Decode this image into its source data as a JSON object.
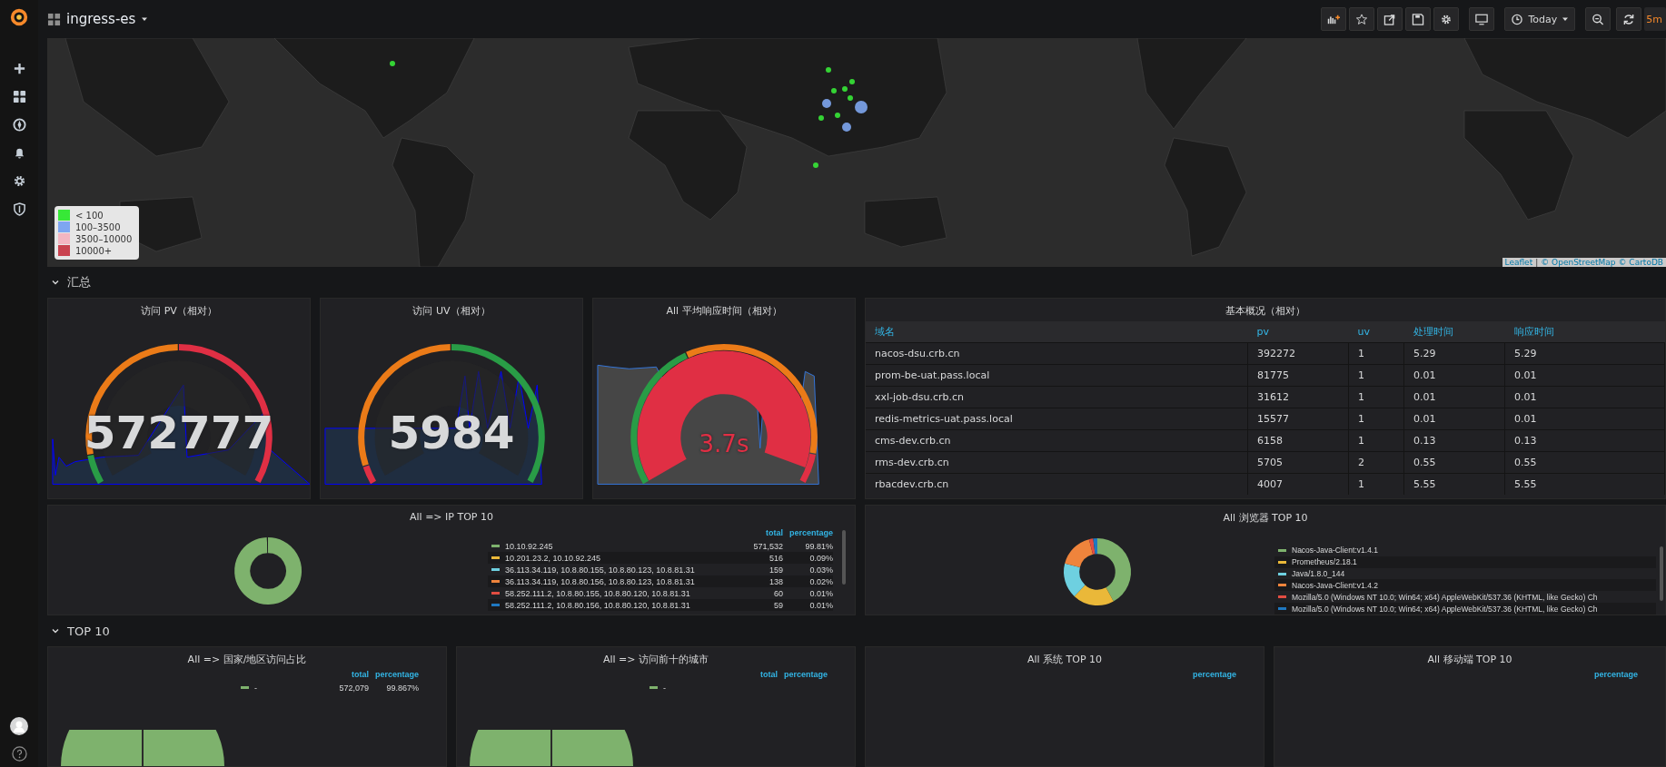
{
  "dashboard": {
    "title": "ingress-es"
  },
  "toolbar": {
    "time_range": "Today",
    "refresh_interval": "5m"
  },
  "map": {
    "legend": [
      {
        "label": "< 100",
        "color": "#37e837"
      },
      {
        "label": "100–3500",
        "color": "#7ea6f0"
      },
      {
        "label": "3500–10000",
        "color": "#f4b6c2"
      },
      {
        "label": "10000+",
        "color": "#c9424f"
      }
    ],
    "attribution": {
      "leaflet": "Leaflet",
      "sep": "|",
      "osm": "© OpenStreetMap",
      "carto": "© CartoDB"
    }
  },
  "rows": [
    {
      "title": "汇总",
      "expanded": true
    },
    {
      "title": "TOP 10",
      "expanded": true
    }
  ],
  "gauges": [
    {
      "title": "访问 PV（相对）",
      "value": "572777",
      "color": "#d8d9da"
    },
    {
      "title": "访问 UV（相对）",
      "value": "5984",
      "color": "#d8d9da"
    },
    {
      "title": "All 平均响应时间（相对）",
      "value": "3.7s",
      "color": "#e02f44"
    }
  ],
  "table": {
    "title": "基本概况（相对）",
    "columns": [
      "域名",
      "pv",
      "uv",
      "处理时间",
      "响应时间"
    ],
    "rows": [
      [
        "nacos-dsu.crb.cn",
        "392272",
        "1",
        "5.29",
        "5.29"
      ],
      [
        "prom-be-uat.pass.local",
        "81775",
        "1",
        "0.01",
        "0.01"
      ],
      [
        "xxl-job-dsu.crb.cn",
        "31612",
        "1",
        "0.01",
        "0.01"
      ],
      [
        "redis-metrics-uat.pass.local",
        "15577",
        "1",
        "0.01",
        "0.01"
      ],
      [
        "cms-dev.crb.cn",
        "6158",
        "1",
        "0.13",
        "0.13"
      ],
      [
        "rms-dev.crb.cn",
        "5705",
        "2",
        "0.55",
        "0.55"
      ],
      [
        "rbacdev.crb.cn",
        "4007",
        "1",
        "5.55",
        "5.55"
      ]
    ]
  },
  "pies": [
    {
      "title": "All => IP TOP 10",
      "headers": [
        "total",
        "percentage"
      ],
      "legend": [
        {
          "label": "10.10.92.245",
          "total": "571,532",
          "percentage": "99.81%",
          "color": "#7eb26d"
        },
        {
          "label": "10.201.23.2, 10.10.92.245",
          "total": "516",
          "percentage": "0.09%",
          "color": "#eab839"
        },
        {
          "label": "36.113.34.119, 10.8.80.155, 10.8.80.123, 10.8.81.31",
          "total": "159",
          "percentage": "0.03%",
          "color": "#6ed0e0"
        },
        {
          "label": "36.113.34.119, 10.8.80.156, 10.8.80.123, 10.8.81.31",
          "total": "138",
          "percentage": "0.02%",
          "color": "#ef843c"
        },
        {
          "label": "58.252.111.2, 10.8.80.155, 10.8.80.120, 10.8.81.31",
          "total": "60",
          "percentage": "0.01%",
          "color": "#e24d42"
        },
        {
          "label": "58.252.111.2, 10.8.80.156, 10.8.80.120, 10.8.81.31",
          "total": "59",
          "percentage": "0.01%",
          "color": "#1f78c1"
        }
      ]
    },
    {
      "title": "All 浏览器 TOP 10",
      "legend": [
        {
          "label": "Nacos-Java-Client:v1.4.1",
          "color": "#7eb26d"
        },
        {
          "label": "Prometheus/2.18.1",
          "color": "#eab839"
        },
        {
          "label": "Java/1.8.0_144",
          "color": "#6ed0e0"
        },
        {
          "label": "Nacos-Java-Client:v1.4.2",
          "color": "#ef843c"
        },
        {
          "label": "Mozilla/5.0 (Windows NT 10.0; Win64; x64) AppleWebKit/537.36 (KHTML, like Gecko) Ch",
          "color": "#e24d42"
        },
        {
          "label": "Mozilla/5.0 (Windows NT 10.0; Win64; x64) AppleWebKit/537.36 (KHTML, like Gecko) Ch",
          "color": "#1f78c1"
        }
      ]
    }
  ],
  "top_panels": [
    {
      "title": "All => 国家/地区访问占比",
      "headers": [
        "total",
        "percentage"
      ],
      "legend": [
        {
          "label": "-",
          "total": "572,079",
          "percentage": "99.867%",
          "color": "#7eb26d"
        }
      ]
    },
    {
      "title": "All => 访问前十的城市",
      "headers": [
        "total",
        "percentage"
      ],
      "legend": [
        {
          "label": "-",
          "color": "#7eb26d"
        }
      ]
    },
    {
      "title": "All 系统 TOP 10",
      "headers": [
        "percentage"
      ]
    },
    {
      "title": "All 移动端 TOP 10",
      "headers": [
        "percentage"
      ]
    }
  ]
}
